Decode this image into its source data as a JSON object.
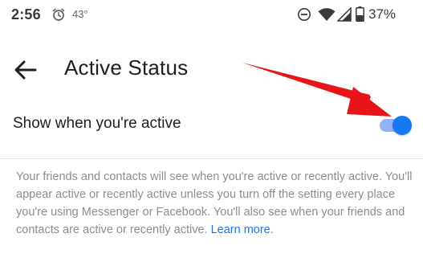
{
  "status_bar": {
    "time": "2:56",
    "temperature": "43°",
    "battery_percent": "37%",
    "icons": [
      "alarm-icon",
      "do-not-disturb-icon",
      "wifi-icon",
      "cell-signal-icon",
      "battery-icon"
    ]
  },
  "header": {
    "title": "Active Status",
    "back_icon": "back-arrow-icon"
  },
  "setting": {
    "label": "Show when you're active",
    "toggle_on": true
  },
  "description": {
    "text": "Your friends and contacts will see when you're active or recently active. You'll appear active or recently active unless you turn off the setting every place you're using Messenger or Facebook. You'll also see when your friends and contacts are active or recently active.",
    "link_text": "Learn more."
  },
  "colors": {
    "accent": "#1877f2",
    "toggle_track": "#8fb3f4",
    "annotation_arrow": "#e8141a",
    "secondary_text": "#8a8d91"
  }
}
